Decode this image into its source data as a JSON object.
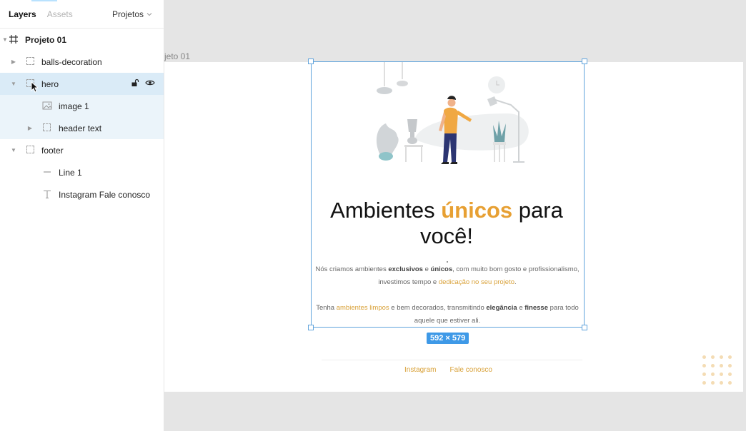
{
  "panel": {
    "tabs": {
      "layers": "Layers",
      "assets": "Assets",
      "projects": "Projetos"
    },
    "root": {
      "label": "Projeto 01",
      "icon": "frame-hash-icon"
    },
    "layers": [
      {
        "label": "balls-decoration",
        "icon": "group-icon",
        "state": "collapsed"
      },
      {
        "label": "hero",
        "icon": "group-icon",
        "state": "expanded",
        "selected": true
      },
      {
        "label": "image 1",
        "icon": "image-icon"
      },
      {
        "label": "header text",
        "icon": "group-icon",
        "state": "collapsed"
      },
      {
        "label": "footer",
        "icon": "group-icon",
        "state": "expanded"
      },
      {
        "label": "Line 1",
        "icon": "line-icon"
      },
      {
        "label": "Instagram Fale conosco",
        "icon": "text-icon"
      }
    ]
  },
  "canvas": {
    "frame_label": "jeto 01",
    "selection_size": "592 × 579",
    "headline": {
      "part1": "Ambientes ",
      "accent": "únicos",
      "part2": " para você!"
    },
    "para1": {
      "t1": "Nós criamos ambientes ",
      "b1": "exclusivos",
      "t2": " e ",
      "b2": "únicos",
      "t3": ", com muito bom gosto e profissionalismo, investimos tempo e ",
      "a1": "dedicação no seu projeto",
      "t4": "."
    },
    "para2": {
      "t1": "Tenha ",
      "a1": "ambientes limpos",
      "t2": " e bem decorados, transmitindo ",
      "b1": "elegância",
      "t3": "  e ",
      "b2": "finesse",
      "t4": " para todo aquele que estiver ali."
    },
    "footer": {
      "instagram": "Instagram",
      "contact": "Fale conosco"
    }
  },
  "colors": {
    "accent": "#e7a033",
    "selection": "#5fa3dc",
    "badge": "#3e99e7",
    "layer_selected": "#daebf7"
  }
}
